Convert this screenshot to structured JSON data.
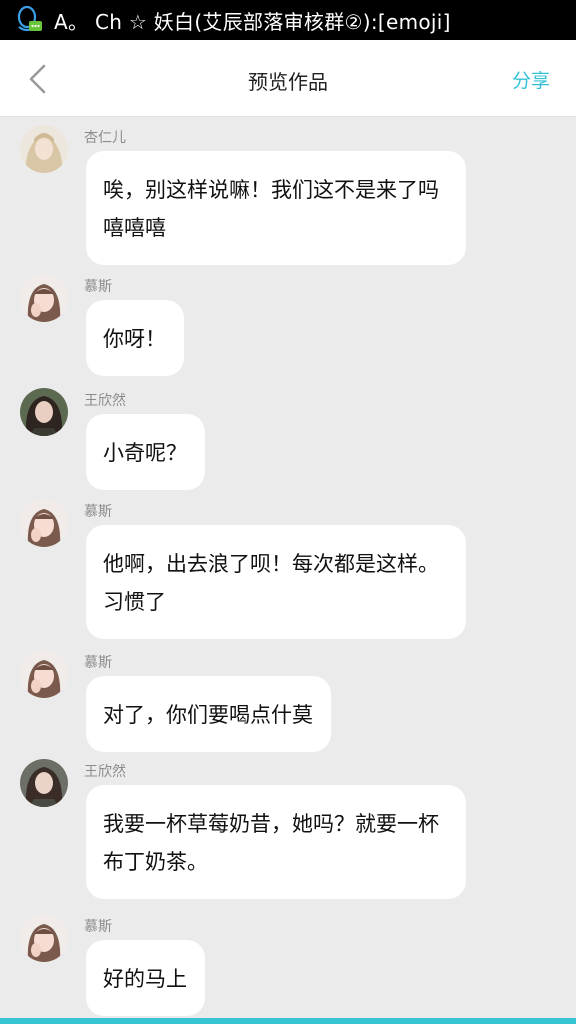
{
  "status_bar": {
    "text": "A。 Ch ☆ 妖白(艾辰部落审核群②):[emoji]"
  },
  "header": {
    "title": "预览作品",
    "share_label": "分享",
    "back_icon": "chevron-left-icon"
  },
  "messages": [
    {
      "sender": "杏仁儿",
      "text": "唉，别这样说嘛！我们这不是来了吗嘻嘻嘻",
      "avatar": "light-hair-avatar"
    },
    {
      "sender": "慕斯",
      "text": "你呀！",
      "avatar": "hand-cheek-avatar"
    },
    {
      "sender": "王欣然",
      "text": "小奇呢？",
      "avatar": "dark-hair-avatar"
    },
    {
      "sender": "慕斯",
      "text": "他啊，出去浪了呗！每次都是这样。习惯了",
      "avatar": "hand-cheek-avatar"
    },
    {
      "sender": "慕斯",
      "text": "对了，你们要喝点什莫",
      "avatar": "hand-cheek-avatar"
    },
    {
      "sender": "王欣然",
      "text": "我要一杯草莓奶昔，她吗？就要一杯布丁奶茶。",
      "avatar": "dark-hair-avatar"
    },
    {
      "sender": "慕斯",
      "text": "好的马上",
      "avatar": "hand-cheek-avatar"
    }
  ],
  "colors": {
    "accent": "#35c3d3",
    "background": "#ebebeb",
    "bubble": "#ffffff"
  }
}
